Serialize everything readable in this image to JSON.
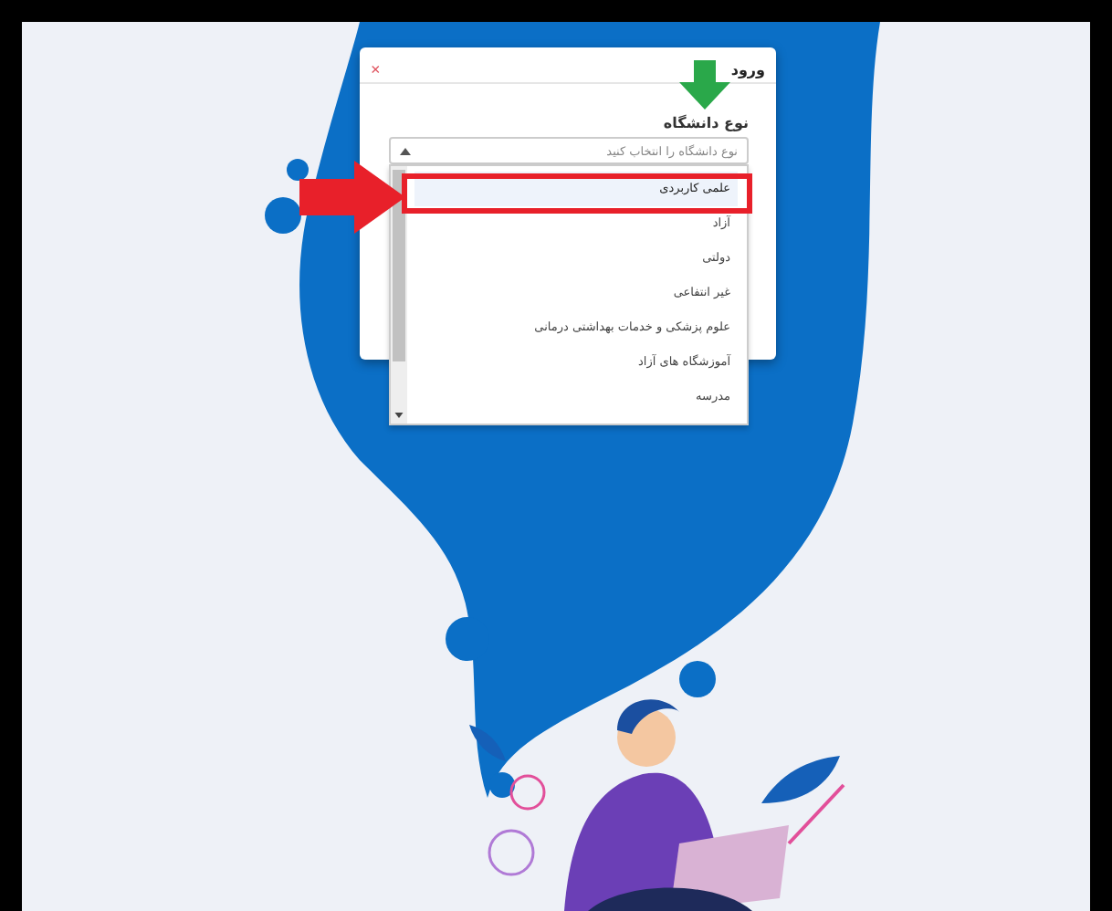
{
  "dialog": {
    "title": "ورود",
    "close": "×",
    "field_label": "نوع دانشگاه",
    "select": {
      "placeholder": "نوع دانشگاه را انتخاب کنید",
      "expanded": true,
      "options": [
        {
          "label": "علمی کاربردی",
          "selected": true
        },
        {
          "label": "آزاد",
          "selected": false
        },
        {
          "label": "دولتی",
          "selected": false
        },
        {
          "label": "غیر انتفاعی",
          "selected": false
        },
        {
          "label": "علوم پزشکی و خدمات بهداشتی درمانی",
          "selected": false
        },
        {
          "label": "آموزشگاه های آزاد",
          "selected": false
        },
        {
          "label": "مدرسه",
          "selected": false
        }
      ]
    }
  }
}
